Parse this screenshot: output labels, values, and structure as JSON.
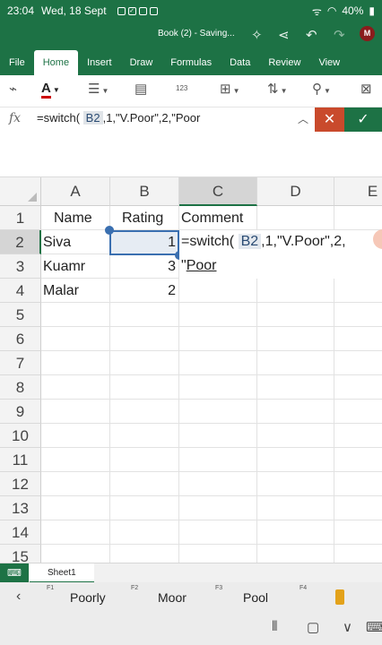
{
  "status": {
    "time": "23:04",
    "date": "Wed, 18 Sept",
    "battery": "40%"
  },
  "title": {
    "text": "Book (2) - Saving...",
    "avatar": "M"
  },
  "tabs": [
    "File",
    "Home",
    "Insert",
    "Draw",
    "Formulas",
    "Data",
    "Review",
    "View"
  ],
  "toolbar": {
    "number_format_label": "123"
  },
  "formula_bar": {
    "fx": "fx",
    "prefix": "=switch(",
    "ref": "B2",
    "suffix": ",1,\"V.Poor\",2,\"Poor",
    "cancel_icon": "✕",
    "confirm_icon": "✓"
  },
  "grid": {
    "columns": [
      "A",
      "B",
      "C",
      "D",
      "E"
    ],
    "rows": [
      "1",
      "2",
      "3",
      "4",
      "5",
      "6",
      "7",
      "8",
      "9",
      "10",
      "11",
      "12",
      "13",
      "14",
      "15"
    ],
    "headers": {
      "A": "Name",
      "B": "Rating",
      "C": "Comment"
    },
    "data": [
      {
        "name": "Siva",
        "rating": "1"
      },
      {
        "name": "Kuamr",
        "rating": "3"
      },
      {
        "name": "Malar",
        "rating": "2"
      }
    ],
    "edit_cell": {
      "line1_prefix": "=switch(",
      "line1_ref": "B2",
      "line1_suffix": ",1,\"V.Poor\",2,",
      "line2_quote": "\"",
      "line2_word": "Poor"
    }
  },
  "sheets": [
    "Sheet1"
  ],
  "suggestions": [
    {
      "fkey": "F1",
      "text": "Poorly"
    },
    {
      "fkey": "F2",
      "text": "Moor"
    },
    {
      "fkey": "F3",
      "text": "Pool"
    },
    {
      "fkey": "F4",
      "text": ""
    }
  ],
  "colors": {
    "excel_green": "#1d7245",
    "cancel_red": "#c94a2c",
    "selection_blue": "#3a6fb0"
  }
}
